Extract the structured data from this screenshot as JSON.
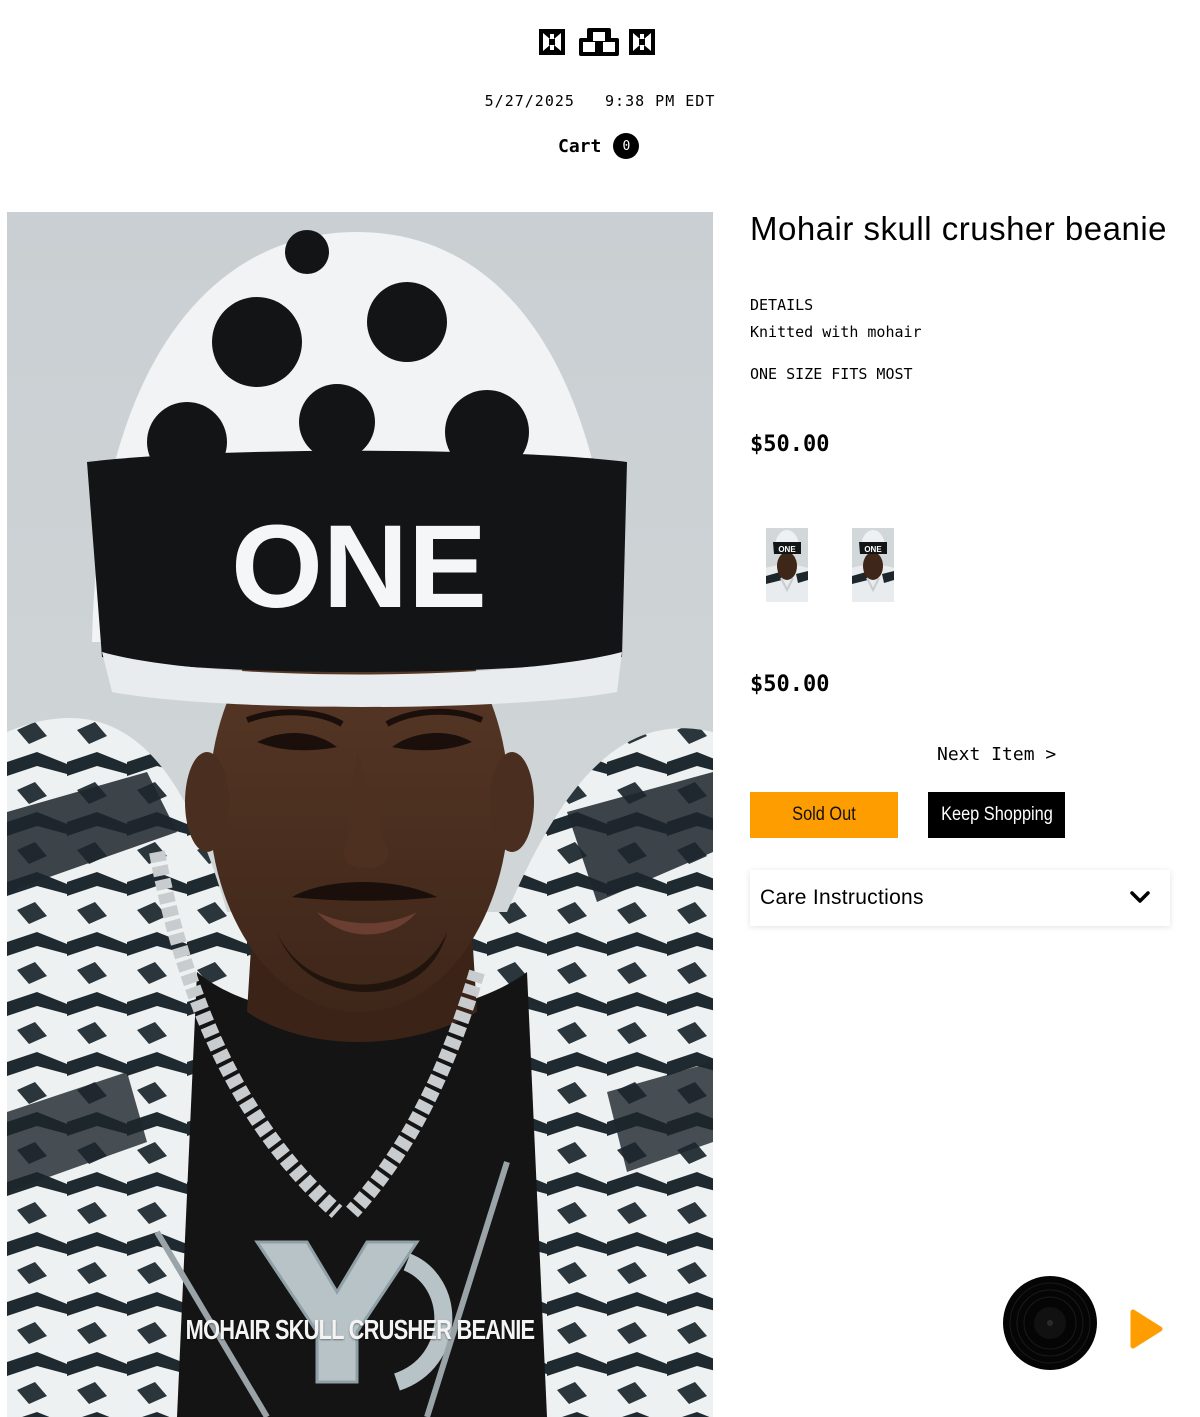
{
  "header": {
    "logo_name": "brand-logo",
    "datetime": "5/27/2025   9:38 PM EDT",
    "cart_label": "Cart",
    "cart_count": "0"
  },
  "hero": {
    "caption": "MOHAIR SKULL CRUSHER BEANIE",
    "beanie_text": "ONE"
  },
  "product": {
    "title": "Mohair skull crusher beanie",
    "details_heading": "DETAILS",
    "details_text": "Knitted with mohair",
    "size_note": "ONE SIZE FITS MOST",
    "price_top": "$50.00",
    "price_bottom": "$50.00",
    "thumbnails": [
      {
        "name": "thumbnail-1",
        "text": "ONE"
      },
      {
        "name": "thumbnail-2",
        "text": "ONE"
      }
    ],
    "next_item_label": "Next Item >",
    "sold_out_label": "Sold Out",
    "keep_shopping_label": "Keep Shopping",
    "care_instructions_label": "Care Instructions"
  },
  "player": {
    "vinyl_icon": "vinyl-record-icon",
    "play_icon": "play-icon"
  },
  "colors": {
    "accent_orange": "#fd9d00",
    "black": "#000000",
    "white": "#ffffff"
  }
}
